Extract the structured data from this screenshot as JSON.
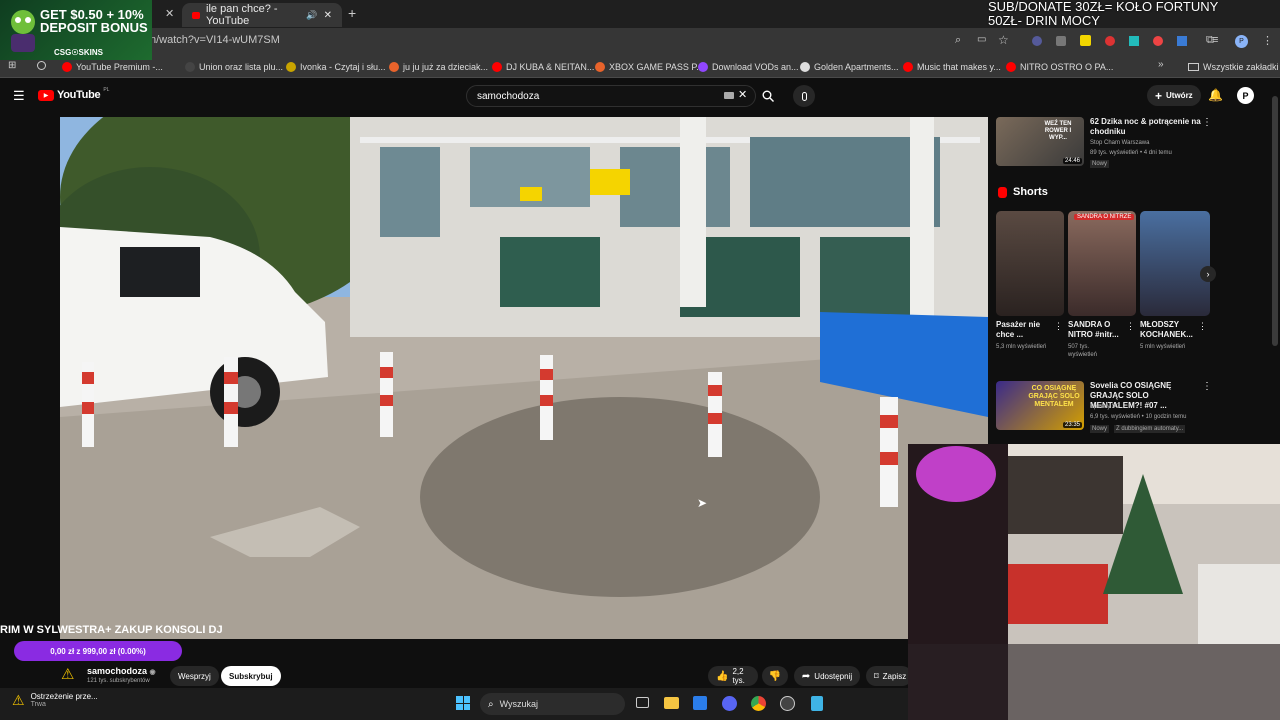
{
  "browser": {
    "tabs": [
      {
        "label": "ile pan chce? - YouTube",
        "active": true
      }
    ],
    "url": "n/watch?v=VI14-wUM7SM",
    "bookmarks": [
      {
        "label": "YouTube Premium -...",
        "color": "#ff0000"
      },
      {
        "label": "Union oraz lista plu...",
        "color": "#444444"
      },
      {
        "label": "Ivonka - Czytaj i słu...",
        "color": "#c8a400"
      },
      {
        "label": "ju ju już za dzieciak...",
        "color": "#e8632b"
      },
      {
        "label": "DJ KUBA & NEITAN...",
        "color": "#ff0000"
      },
      {
        "label": "XBOX GAME PASS P...",
        "color": "#e8632b"
      },
      {
        "label": "Download VODs an...",
        "color": "#9146ff"
      },
      {
        "label": "Golden Apartments...",
        "color": "#dddddd"
      },
      {
        "label": "Music that makes y...",
        "color": "#ff0000"
      },
      {
        "label": "NITRO OSTRO O PA...",
        "color": "#ff0000"
      }
    ],
    "all_bookmarks": "Wszystkie zakładki"
  },
  "promo": {
    "line1": "GET $0.50 + 10%",
    "line2": "DEPOSIT BONUS",
    "brand": "CSG☉SKINS"
  },
  "stream_overlay": {
    "line1": "SUB/DONATE 30ZŁ= KOŁO FORTUNY",
    "line2": "50ZŁ- DRIN MOCY"
  },
  "youtube": {
    "logo": "YouTube",
    "logo_suffix": "PL",
    "search_value": "samochodoza",
    "create_label": "Utwórz",
    "caption": "RIM W SYLWESTRA+ ZAKUP KONSOLI DJ",
    "goal": "0,00 zł z 999,00 zł (0.00%)",
    "channel": {
      "name": "samochodoza",
      "subs": "121 tys. subskrybentów",
      "support": "Wesprzyj",
      "subscribe": "Subskrybuj"
    },
    "actions": {
      "likes": "2,2 tys.",
      "share": "Udostępnij",
      "save": "Zapisz"
    }
  },
  "sidebar": {
    "top_video": {
      "title": "62 Dzika noc & potrącenie na chodniku",
      "channel": "Stop Cham Warszawa",
      "meta": "89 tys. wyświetleń • 4 dni temu",
      "badge": "Nowy",
      "duration": "24:46",
      "thumb_text": "WEŹ TEN ROWER I WYP..."
    },
    "shorts_title": "Shorts",
    "shorts": [
      {
        "title": "Pasażer nie chce ...",
        "views": "5,3 mln wyświetleń",
        "tag": ""
      },
      {
        "title": "SANDRA O NITRO #nitr...",
        "views": "507 tys. wyświetleń",
        "tag": "SANDRA O NITRZE"
      },
      {
        "title": "MŁODSZY KOCHANEK...",
        "views": "5 mln wyświetleń",
        "tag": ""
      }
    ],
    "bottom_video": {
      "title": "Sovelia CO OSIĄGNĘ GRAJĄC SOLO MENTALEM?! #07 ...",
      "channel": "Speedy V2",
      "meta": "6,9 tys. wyświetleń • 10 godzin temu",
      "badge": "Nowy",
      "badge2": "Z dubbingiem automaty...",
      "duration": "23:35",
      "thumb_text": "CO OSIĄGNĘ GRAJĄC SOLO MENTALEM"
    }
  },
  "taskbar": {
    "notification_title": "Ostrzeżenie prze...",
    "notification_sub": "Trwa",
    "search_placeholder": "Wyszukaj"
  },
  "colors": {
    "accent": "#ff0000",
    "goal_bar": "#8a2be2",
    "chrome": "#363636"
  }
}
